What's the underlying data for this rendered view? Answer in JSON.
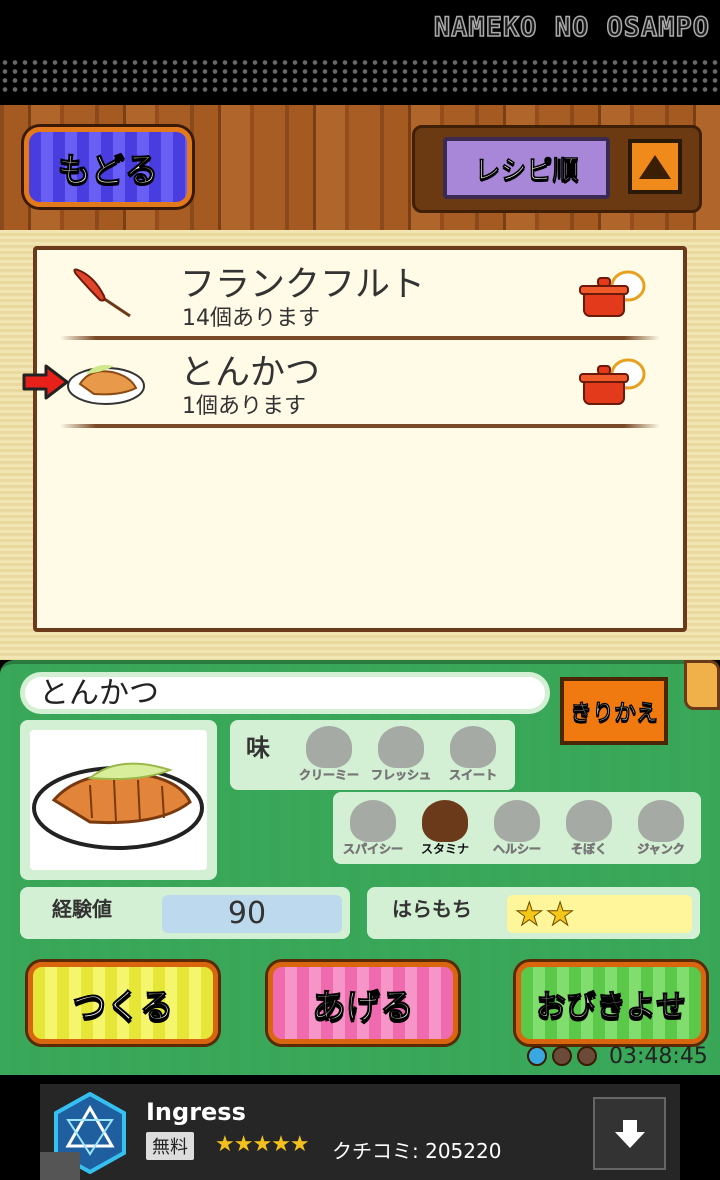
{
  "header": {
    "app_title": "NAMEKO NO OSAMPO"
  },
  "toolbar": {
    "back_label": "もどる",
    "sort_label": "レシピ順",
    "sort_direction": "ascending"
  },
  "recipe_list": {
    "items": [
      {
        "name": "フランクフルト",
        "count_text": "14個あります",
        "icon": "sausage-icon",
        "status_icon": "cooking-pot-icon"
      },
      {
        "name": "とんかつ",
        "count_text": "1個あります",
        "icon": "tonkatsu-icon",
        "status_icon": "cooking-pot-icon",
        "selected": true
      }
    ]
  },
  "detail": {
    "name": "とんかつ",
    "switch_label": "きりかえ",
    "taste_label": "味",
    "tastes": [
      {
        "label": "クリーミー",
        "active": false
      },
      {
        "label": "フレッシュ",
        "active": false
      },
      {
        "label": "スイート",
        "active": false
      },
      {
        "label": "スパイシー",
        "active": false
      },
      {
        "label": "スタミナ",
        "active": true
      },
      {
        "label": "ヘルシー",
        "active": false
      },
      {
        "label": "そぼく",
        "active": false
      },
      {
        "label": "ジャンク",
        "active": false
      }
    ],
    "exp_label": "経験値",
    "exp_value": "90",
    "satiety_label": "はらもち",
    "satiety_stars": "★★",
    "satiety_stars_count": 2
  },
  "actions": {
    "make_label": "つくる",
    "give_label": "あげる",
    "lure_label": "おびきよせ"
  },
  "status": {
    "timer": "03:48:45",
    "lure_dots": [
      {
        "color": "#39a8e0"
      },
      {
        "color": "#6b4a3a"
      },
      {
        "color": "#6b4a3a"
      }
    ]
  },
  "ad": {
    "title": "Ingress",
    "price_label": "無料",
    "rating_stars": "★★★★★",
    "rating_value": 4.5,
    "review_text": "クチコミ: 205220",
    "icon": "ingress-logo-icon"
  },
  "colors": {
    "wood": "#a55a22",
    "cream": "#fffbe6",
    "green_panel": "#3aa85a",
    "accent_orange": "#f07a10"
  }
}
